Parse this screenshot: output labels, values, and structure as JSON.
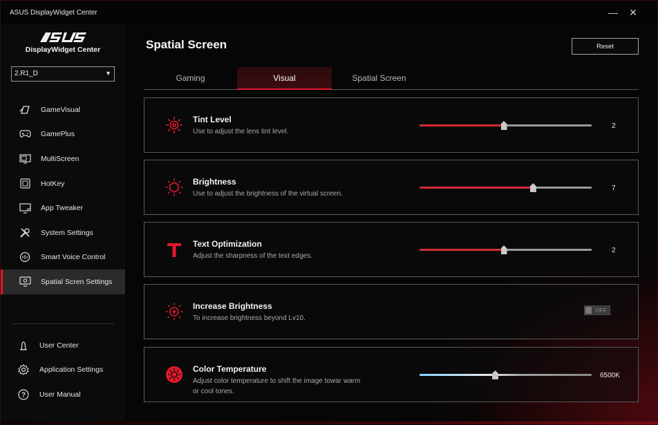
{
  "app": {
    "title": "ASUS DisplayWidget Center",
    "logo_text": "ASUS",
    "logo_subtitle": "DisplayWidget Center",
    "minimize_glyph": "—",
    "close_glyph": "✕"
  },
  "sidebar": {
    "device": "2.R1_D",
    "items": [
      {
        "label": "GameVisual",
        "icon": "gamevisual-icon"
      },
      {
        "label": "GamePlus",
        "icon": "gamepad-icon"
      },
      {
        "label": "MultiScreen",
        "icon": "multiscreen-icon"
      },
      {
        "label": "HotKey",
        "icon": "hotkey-icon"
      },
      {
        "label": "App Tweaker",
        "icon": "monitor-check-icon"
      },
      {
        "label": "System Settings",
        "icon": "tools-icon"
      },
      {
        "label": "Smart Voice Control",
        "icon": "voice-icon"
      },
      {
        "label": "Spatial Scren Settings",
        "icon": "spatial-icon",
        "active": true
      }
    ],
    "bottom_items": [
      {
        "label": "User Center",
        "icon": "user-icon"
      },
      {
        "label": "Application Settings",
        "icon": "gear-icon"
      },
      {
        "label": "User Manual",
        "icon": "help-icon"
      }
    ]
  },
  "main": {
    "title": "Spatial Screen",
    "reset_label": "Reset",
    "tabs": [
      {
        "label": "Gaming"
      },
      {
        "label": "Visual",
        "active": true
      },
      {
        "label": "Spatial Screen"
      }
    ],
    "settings": [
      {
        "title": "Tint Level",
        "desc": "Use to adjust the lens tint level.",
        "value": "2",
        "level": 0.49,
        "icon": "tint-level-icon"
      },
      {
        "title": "Brightness",
        "desc": "Use to adjust the brightness of the virtual screen.",
        "value": "7",
        "level": 0.66,
        "icon": "brightness-icon"
      },
      {
        "title": "Text Optimization",
        "desc": "Adjust the sharpness of the text edges.",
        "value": "2",
        "level": 0.49,
        "icon": "text-icon"
      },
      {
        "title": "Increase Brightness",
        "desc": "To increase brightness beyond Lv10.",
        "toggle": "OFF",
        "icon": "increase-brightness-icon"
      },
      {
        "title": "Color Temperature",
        "desc": "Adjust color temperature to shift the image towar warm or cool tones.",
        "value": "6500K",
        "level": 0.44,
        "icon": "color-temperature-icon"
      }
    ]
  },
  "colors": {
    "accent": "#e3192b",
    "active_bg": "#2b2b2b"
  }
}
